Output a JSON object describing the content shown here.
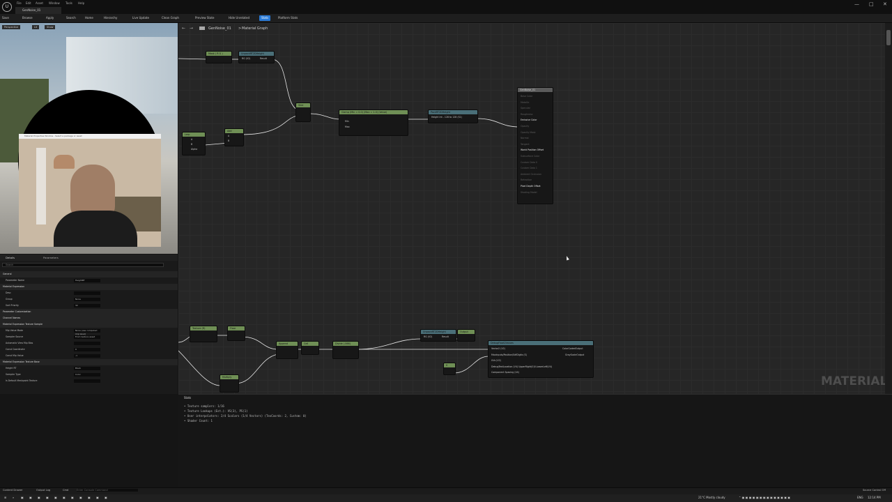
{
  "window": {
    "doc_tab": "GenNoise_01",
    "menu": [
      "File",
      "Edit",
      "Asset",
      "Window",
      "Tools",
      "Help"
    ]
  },
  "toolbar": {
    "items": [
      "Save",
      "Browse",
      "Apply",
      "Search",
      "Home",
      "Hierarchy",
      "Live Update",
      "Clean Graph",
      "Preview State",
      "Hide Unrelated",
      "Stats",
      "Platform Stats"
    ],
    "active": "Stats"
  },
  "preview": {
    "tags": [
      "Perspective",
      "Lit",
      "Show"
    ],
    "webcam_title": "Material Properties Window - Select a package or asset"
  },
  "details": {
    "tabs": [
      "Details",
      "Parameters"
    ],
    "search_placeholder": "Search",
    "rows": [
      {
        "label": "General",
        "section": true
      },
      {
        "label": "Parameter Name",
        "value": "HeightRT"
      },
      {
        "label": "Material Expression",
        "section": true
      },
      {
        "label": "Desc",
        "value": ""
      },
      {
        "label": "Group",
        "value": "None"
      },
      {
        "label": "Sort Priority",
        "value": "32"
      },
      {
        "label": "Parameter Customization",
        "section": true
      },
      {
        "label": "Channel Names",
        "section": true
      },
      {
        "label": "Material Expression Texture Sample",
        "section": true
      },
      {
        "label": "Mip Value Mode",
        "value": "None (use computed mip level)"
      },
      {
        "label": "Sampler Source",
        "value": "From texture asset"
      },
      {
        "label": "Automatic View Mip Bias",
        "value": ""
      },
      {
        "label": "Const Coordinate",
        "value": "0"
      },
      {
        "label": "Const Mip Value",
        "value": "-1"
      },
      {
        "label": "Material Expression Texture Base",
        "section": true
      },
      {
        "label": "Height RT",
        "value": "Black"
      },
      {
        "label": "Sampler Type",
        "value": "Color"
      },
      {
        "label": "Is Default Meshpaint Texture",
        "value": ""
      }
    ]
  },
  "graph": {
    "breadcrumb_asset": "GenNoise_01",
    "breadcrumb_graph": "Material Graph",
    "watermark": "MATERIAL",
    "nodes": {
      "mask": "Mask ( R G )",
      "unpack": "UnpackRT2DHeight",
      "unpack_pins": [
        "RG (V2)",
        "Result"
      ],
      "sine": "Sine",
      "lerp": "Lerp",
      "lerp_pins": [
        "A",
        "B",
        "Alpha"
      ],
      "add": "Add",
      "add_pins": [
        "A",
        "B"
      ],
      "clamp": "Clamp (Min = 0.0) (Max = 1.0) (Value)",
      "clamp_pins": [
        "Min",
        "Max"
      ],
      "pack": "PackRT2DHeight",
      "pack_pins": [
        "Height Int - 128 to 128 (S1)"
      ],
      "result": "GenNoise_01",
      "result_pins": [
        "Base Color",
        "Metallic",
        "Specular",
        "Roughness",
        "Emissive Color",
        "Opacity",
        "Opacity Mask",
        "Normal",
        "Tangent",
        "World Position Offset",
        "Subsurface Color",
        "Custom Data 0",
        "Custom Data 1",
        "Ambient Occlusion",
        "Refraction",
        "Pixel Depth Offset",
        "Shading Model"
      ],
      "b_texture": "Texture (R)",
      "b_floor": "Floor",
      "b_append": "Append",
      "b_mul": "Multiply",
      "b_divide": "Divide (.066)",
      "b_unpack2": "UnpackRT2DHeight",
      "b_unpack2_pins": [
        "RG (V2)",
        "Result"
      ],
      "b_output": "Output",
      "b_const": "0",
      "b_ceil": "Ceil",
      "debug": "DebugFloat2Values",
      "debug_pins": [
        "Vector2 (V2)",
        "MaxInputs/Position/SdfDigits (S)",
        "UVs (V2)",
        "DebugTextLocation (V4) UpperRight(0)0.LowerLeft(V4)",
        "Component Spacing (V4)"
      ],
      "debug_out": [
        "ColorCodedOutput",
        "GrayScaleOutput"
      ]
    }
  },
  "stats": {
    "title": "Stats",
    "lines": [
      "Texture samplers: 1/16",
      "Texture Lookups (Est.): VS(3), PS(1)",
      "User interpolators: 2/4 Scalars (1/4 Vectors) (TexCoords: 2, Custom: 0)",
      "Shader Count: 1"
    ]
  },
  "statusbar": {
    "items": [
      "Content Drawer",
      "Output Log",
      "Cmd",
      "Enter Console Command"
    ],
    "right": "Source Control Off"
  },
  "taskbar": {
    "weather": "21°C  Mostly cloudy",
    "lang": "ENG",
    "time": "12:14 PM"
  }
}
